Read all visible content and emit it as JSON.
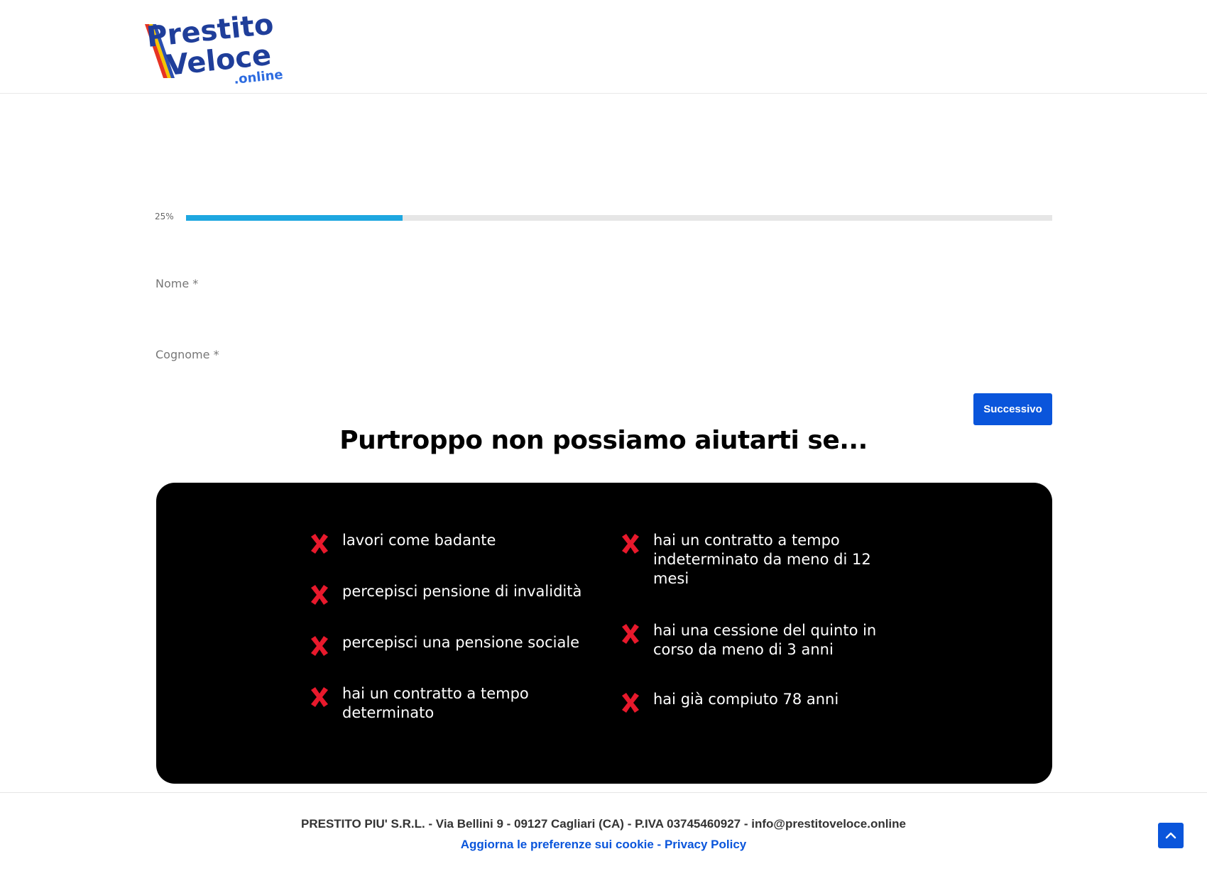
{
  "header": {
    "logo": {
      "word1": "Prestito",
      "word2": "Veloce",
      "suffix": ".online",
      "colors": {
        "text": "#1f3e9a",
        "suffix": "#2c6be0",
        "stripe1": "#e63323",
        "stripe2": "#f5c400",
        "stripe3": "#2c4fb0"
      }
    }
  },
  "form": {
    "progress": {
      "label": "25%",
      "value": 0.25,
      "fill_color": "#1ea7e0",
      "track_color": "#e6e6e6"
    },
    "fields": [
      {
        "label": "Nome *",
        "value": ""
      },
      {
        "label": "Cognome *",
        "value": ""
      }
    ],
    "next_button": "Successivo"
  },
  "exclusions": {
    "title": "Purtroppo non possiamo aiutarti se...",
    "left": [
      "lavori come badante",
      "percepisci pensione di invalidità",
      "percepisci una pensione sociale",
      "hai un contratto a tempo determinato"
    ],
    "right": [
      "hai un contratto a tempo indeterminato da meno di 12 mesi",
      "hai una cessione del quinto in corso da meno di 3 anni",
      "hai già compiuto 78 anni"
    ],
    "icon": "red-cross-icon",
    "icon_color": "#e8192c"
  },
  "footer": {
    "company_line": "PRESTITO PIU' S.R.L. - Via Bellini 9 - 09127 Cagliari (CA) - P.IVA 03745460927 - info@prestitoveloce.online",
    "cookie_link": "Aggiorna le preferenze sui cookie",
    "separator": " - ",
    "privacy_link": "Privacy Policy",
    "scroll_top_icon": "chevron-up-icon"
  }
}
